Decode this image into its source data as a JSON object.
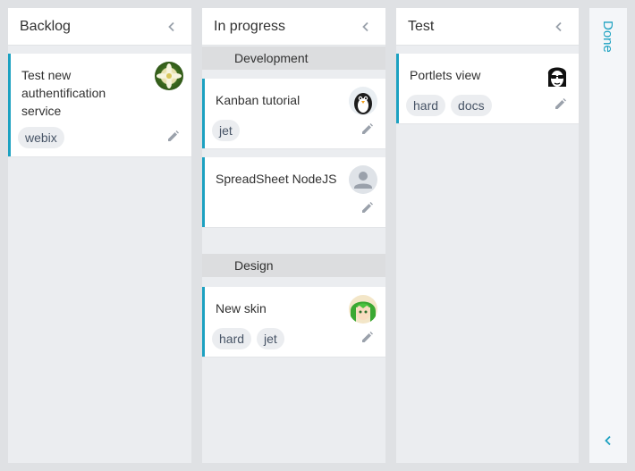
{
  "columns": {
    "backlog": {
      "title": "Backlog",
      "cards": [
        {
          "title": "Test new authentification service",
          "tags": [
            "webix"
          ],
          "avatar": "flower-avatar-icon"
        }
      ]
    },
    "in_progress": {
      "title": "In progress",
      "groups": [
        {
          "name": "Development",
          "cards": [
            {
              "title": "Kanban tutorial",
              "tags": [
                "jet"
              ],
              "avatar": "penguin-avatar-icon"
            },
            {
              "title": "SpreadSheet NodeJS",
              "tags": [],
              "avatar": "default-user-avatar-icon"
            }
          ]
        },
        {
          "name": "Design",
          "cards": [
            {
              "title": "New skin",
              "tags": [
                "hard",
                "jet"
              ],
              "avatar": "anime-avatar-icon"
            }
          ]
        }
      ]
    },
    "test": {
      "title": "Test",
      "cards": [
        {
          "title": "Portlets view",
          "tags": [
            "hard",
            "docs"
          ],
          "avatar": "sunglasses-avatar-icon"
        }
      ]
    },
    "done": {
      "title": "Done"
    }
  },
  "colors": {
    "accent": "#1ca1c1",
    "background": "#dfe1e4",
    "column_bg": "#ebedf0",
    "card_bg": "#ffffff",
    "tag_bg": "#ebedf0",
    "group_header_bg": "#dcdddf"
  }
}
